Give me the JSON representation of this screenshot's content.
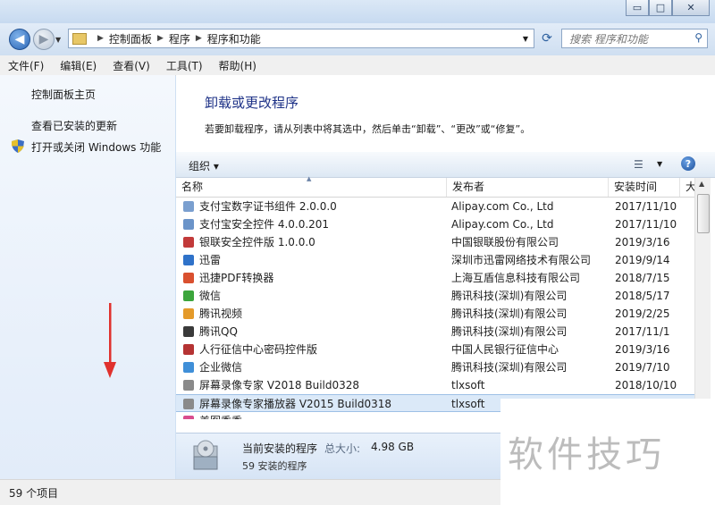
{
  "window": {
    "controls": {
      "minimize": "▭",
      "maximize": "□",
      "close": "✕"
    }
  },
  "nav": {
    "breadcrumbs": [
      "控制面板",
      "程序",
      "程序和功能"
    ],
    "search_placeholder": "搜索 程序和功能"
  },
  "menu": [
    "文件(F)",
    "编辑(E)",
    "查看(V)",
    "工具(T)",
    "帮助(H)"
  ],
  "sidebar": {
    "home": "控制面板主页",
    "updates": "查看已安装的更新",
    "features": "打开或关闭 Windows 功能"
  },
  "main": {
    "title": "卸载或更改程序",
    "description": "若要卸载程序，请从列表中将其选中，然后单击“卸载”、“更改”或“修复”。",
    "toolbar": {
      "organize": "组织"
    },
    "columns": [
      "名称",
      "发布者",
      "安装时间",
      "大"
    ],
    "rows": [
      {
        "name": "支付宝数字证书组件 2.0.0.0",
        "pub": "Alipay.com Co., Ltd",
        "date": "2017/11/10",
        "icon": "#7a9fcf"
      },
      {
        "name": "支付宝安全控件 4.0.0.201",
        "pub": "Alipay.com Co., Ltd",
        "date": "2017/11/10",
        "icon": "#6b94c9"
      },
      {
        "name": "银联安全控件版 1.0.0.0",
        "pub": "中国银联股份有限公司",
        "date": "2019/3/16",
        "icon": "#c23a3a"
      },
      {
        "name": "迅雷",
        "pub": "深圳市迅雷网络技术有限公司",
        "date": "2019/9/14",
        "icon": "#2f72c9"
      },
      {
        "name": "迅捷PDF转换器",
        "pub": "上海互盾信息科技有限公司",
        "date": "2018/7/15",
        "icon": "#d9502f"
      },
      {
        "name": "微信",
        "pub": "腾讯科技(深圳)有限公司",
        "date": "2018/5/17",
        "icon": "#3ca53c"
      },
      {
        "name": "腾讯视频",
        "pub": "腾讯科技(深圳)有限公司",
        "date": "2019/2/25",
        "icon": "#e49a2a"
      },
      {
        "name": "腾讯QQ",
        "pub": "腾讯科技(深圳)有限公司",
        "date": "2017/11/1",
        "icon": "#3a3a3a"
      },
      {
        "name": "人行征信中心密码控件版",
        "pub": "中国人民银行征信中心",
        "date": "2019/3/16",
        "icon": "#b53333"
      },
      {
        "name": "企业微信",
        "pub": "腾讯科技(深圳)有限公司",
        "date": "2019/7/10",
        "icon": "#3f8fd8"
      },
      {
        "name": "屏幕录像专家 V2018 Build0328",
        "pub": "tlxsoft",
        "date": "2018/10/10",
        "icon": "#8a8a8a"
      },
      {
        "name": "屏幕录像专家播放器 V2015 Build0318",
        "pub": "tlxsoft",
        "date": "",
        "icon": "#8a8a8a",
        "selected": true
      },
      {
        "name": "美图秀秀",
        "pub": "",
        "date": "",
        "icon": "#d94d8e"
      }
    ]
  },
  "details": {
    "title": "当前安装的程序",
    "size_label": "总大小:",
    "size_value": "4.98 GB",
    "count": "59 安装的程序"
  },
  "status": {
    "items": "59 个项目"
  },
  "watermark": "软件技巧",
  "colors": {
    "title": "#1e3287",
    "annotation_arrow": "#e0312d"
  }
}
